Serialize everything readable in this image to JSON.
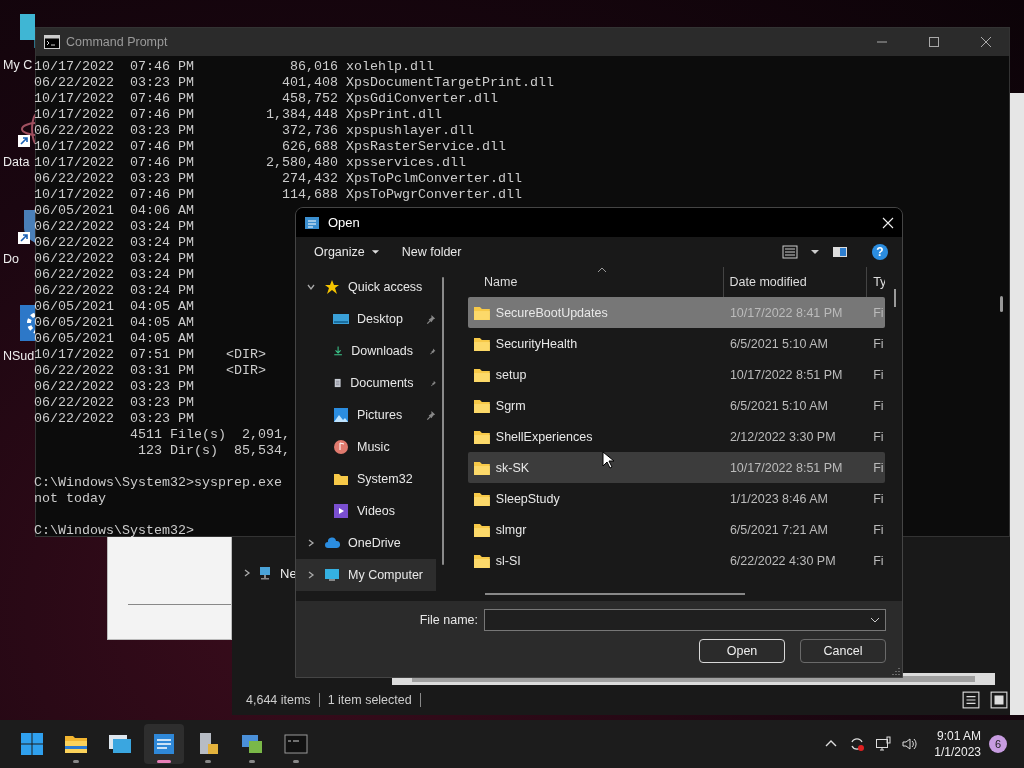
{
  "desktop_icons": [
    {
      "label": "My C",
      "kind": "computer",
      "shortcut": false
    },
    {
      "label": "Data",
      "kind": "atom",
      "shortcut": true
    },
    {
      "label": "Do",
      "kind": "shield",
      "shortcut": true
    },
    {
      "label": "NSud",
      "kind": "gear",
      "shortcut": false
    }
  ],
  "explorer_window": {
    "nav_items": [
      {
        "label": "Ne",
        "expanded": false
      }
    ],
    "status": [
      "4,644 items",
      "1 item selected"
    ]
  },
  "command_prompt": {
    "title": "Command Prompt",
    "blocks": [
      {
        "lines": [
          {
            "text": "10/17/2022  07:46 PM            86,016 xolehlp.dll"
          },
          {
            "text": "06/22/2022  03:23 PM           401,408 XpsDocumentTargetPrint.dll"
          },
          {
            "text": "10/17/2022  07:46 PM           458,752 XpsGdiConverter.dll"
          },
          {
            "text": "10/17/2022  07:46 PM         1,384,448 XpsPrint.dll"
          },
          {
            "text": "06/22/2022  03:23 PM           372,736 xpspushlayer.dll"
          },
          {
            "text": "10/17/2022  07:46 PM           626,688 XpsRasterService.dll"
          },
          {
            "text": "10/17/2022  07:46 PM         2,580,480 xpsservices.dll"
          },
          {
            "text": "06/22/2022  03:23 PM           274,432 XpsToPclmConverter.dll"
          },
          {
            "text": "10/17/2022  07:46 PM           114,688 XpsToPwgrConverter.dll"
          },
          {
            "text": "06/05/2021  04:06 AM"
          },
          {
            "text": "06/22/2022  03:24 PM"
          },
          {
            "text": "06/22/2022  03:24 PM"
          },
          {
            "text": "06/22/2022  03:24 PM"
          },
          {
            "text": "06/22/2022  03:24 PM"
          },
          {
            "text": "06/22/2022  03:24 PM"
          },
          {
            "text": "06/05/2021  04:05 AM"
          },
          {
            "text": "06/05/2021  04:05 AM"
          },
          {
            "text": "06/05/2021  04:05 AM"
          },
          {
            "text": "10/17/2022  07:51 PM    <DIR>"
          },
          {
            "text": "06/22/2022  03:31 PM    <DIR>"
          },
          {
            "text": "06/22/2022  03:23 PM"
          },
          {
            "text": "06/22/2022  03:23 PM"
          },
          {
            "text": "06/22/2022  03:23 PM"
          },
          {
            "text": "            4511 File(s)  2,091,"
          },
          {
            "text": "             123 Dir(s)  85,534,"
          }
        ]
      },
      {
        "lines": [
          {
            "text": "C:\\Windows\\System32>sysprep.exe"
          },
          {
            "text": "not today"
          }
        ]
      },
      {
        "lines": [
          {
            "text": "C:\\Windows\\System32>"
          }
        ]
      }
    ]
  },
  "open_dialog": {
    "title": "Open",
    "toolbar": {
      "organize": "Organize",
      "new_folder": "New folder",
      "help": "?"
    },
    "nav": [
      {
        "label": "Quick access",
        "kind": "star",
        "expanded": true,
        "selected": false,
        "children": [
          {
            "label": "Desktop",
            "kind": "desktop",
            "pinned": true,
            "selected": false
          },
          {
            "label": "Downloads",
            "kind": "download",
            "pinned": true,
            "selected": false
          },
          {
            "label": "Documents",
            "kind": "document",
            "pinned": true,
            "selected": false
          },
          {
            "label": "Pictures",
            "kind": "pictures",
            "pinned": true,
            "selected": false
          },
          {
            "label": "Music",
            "kind": "music",
            "pinned": false,
            "selected": false
          },
          {
            "label": "System32",
            "kind": "folder",
            "pinned": false,
            "selected": false
          },
          {
            "label": "Videos",
            "kind": "video",
            "pinned": false,
            "selected": false
          }
        ]
      },
      {
        "label": "OneDrive",
        "kind": "cloud",
        "expanded": false,
        "selected": false
      },
      {
        "label": "My Computer",
        "kind": "computer",
        "expanded": false,
        "selected": true
      }
    ],
    "columns": [
      "Name",
      "Date modified",
      "Ty"
    ],
    "rows": [
      {
        "name": "SecureBootUpdates",
        "date": "10/17/2022 8:41 PM",
        "type": "Fi",
        "selected": true,
        "hovered": false
      },
      {
        "name": "SecurityHealth",
        "date": "6/5/2021 5:10 AM",
        "type": "Fi",
        "selected": false,
        "hovered": false
      },
      {
        "name": "setup",
        "date": "10/17/2022 8:51 PM",
        "type": "Fi",
        "selected": false,
        "hovered": false
      },
      {
        "name": "Sgrm",
        "date": "6/5/2021 5:10 AM",
        "type": "Fi",
        "selected": false,
        "hovered": false
      },
      {
        "name": "ShellExperiences",
        "date": "2/12/2022 3:30 PM",
        "type": "Fi",
        "selected": false,
        "hovered": false
      },
      {
        "name": "sk-SK",
        "date": "10/17/2022 8:51 PM",
        "type": "Fi",
        "selected": false,
        "hovered": true
      },
      {
        "name": "SleepStudy",
        "date": "1/1/2023 8:46 AM",
        "type": "Fi",
        "selected": false,
        "hovered": false
      },
      {
        "name": "slmgr",
        "date": "6/5/2021 7:21 AM",
        "type": "Fi",
        "selected": false,
        "hovered": false
      },
      {
        "name": "sl-SI",
        "date": "6/22/2022 4:30 PM",
        "type": "Fi",
        "selected": false,
        "hovered": false
      }
    ],
    "file_name_label": "File name:",
    "buttons": [
      {
        "label": "Open",
        "kind": "primary"
      },
      {
        "label": "Cancel",
        "kind": "secondary"
      }
    ]
  },
  "taskbar": {
    "apps": [
      {
        "kind": "start",
        "selected": false,
        "running": false
      },
      {
        "kind": "explorer",
        "selected": false,
        "running": true
      },
      {
        "kind": "window",
        "selected": false,
        "running": false
      },
      {
        "kind": "panel",
        "selected": true,
        "running": true
      },
      {
        "kind": "server",
        "selected": false,
        "running": true
      },
      {
        "kind": "network",
        "selected": false,
        "running": true
      },
      {
        "kind": "terminal",
        "selected": false,
        "running": true
      }
    ],
    "time": "9:01 AM",
    "date": "1/1/2023",
    "notifications": "6"
  }
}
